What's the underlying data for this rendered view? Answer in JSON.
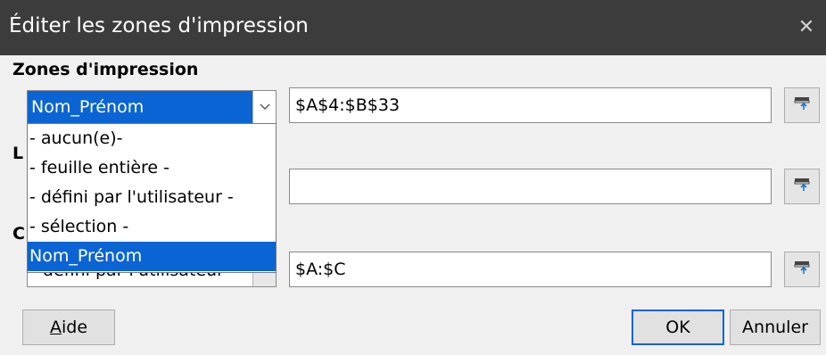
{
  "dialog": {
    "title": "Éditer les zones d'impression",
    "close_label": "✕"
  },
  "print_ranges": {
    "heading": "Zones d'impression",
    "selected": "Nom_Prénom",
    "value": "$A$4:$B$33"
  },
  "rows_to_repeat": {
    "heading_fragment": "L",
    "value": ""
  },
  "columns_to_repeat": {
    "heading_fragment": "C",
    "selected": "- défini par l'utilisateur -",
    "value": "$A:$C"
  },
  "dropdown": {
    "options": [
      "- aucun(e)-",
      "- feuille entière -",
      "- défini par l'utilisateur -",
      "- sélection -",
      "Nom_Prénom"
    ],
    "active_index": 4
  },
  "buttons": {
    "help": "Aide",
    "ok": "OK",
    "cancel": "Annuler"
  },
  "icons": {
    "shrink": "shrink-icon",
    "chevron": "chevron-down-icon",
    "close": "close-icon"
  }
}
